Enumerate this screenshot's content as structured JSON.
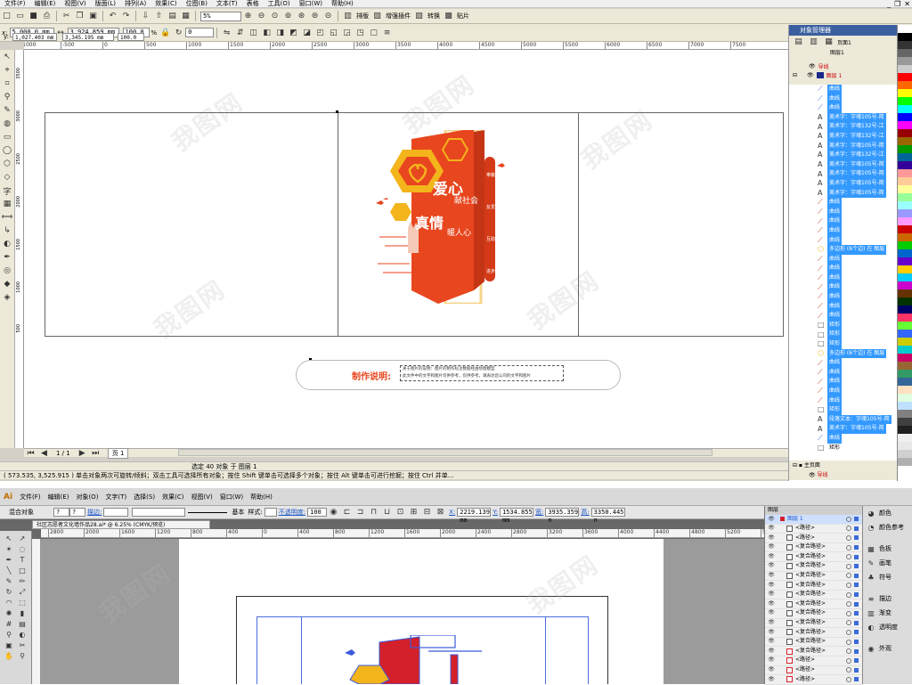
{
  "app1": {
    "menu": [
      "文件(F)",
      "编辑(E)",
      "视图(V)",
      "版面(L)",
      "排列(A)",
      "效果(C)",
      "位图(B)",
      "文本(T)",
      "表格",
      "工具(O)",
      "窗口(W)",
      "帮助(H)"
    ],
    "zoom": "5%",
    "toolbar_buttons": [
      "排版",
      "增强插件",
      "转换",
      "贴片"
    ],
    "pos_x": "5,000.0 mm",
    "pos_y": "1,027.403 mm",
    "size_w": "3,924.859 mm",
    "size_h": "3,345.195 mm",
    "scale_x": "100.0",
    "scale_y": "100.0",
    "pct": "%",
    "rotation": "0",
    "ruler_ticks": [
      "-1000",
      "-500",
      "0",
      "500",
      "1000",
      "1500",
      "2000",
      "2500",
      "3000",
      "3500",
      "4000",
      "4500",
      "5000",
      "5500",
      "6000",
      "6500",
      "7000",
      "7500"
    ],
    "v_ruler_ticks": [
      "3500",
      "3000",
      "2500",
      "2000",
      "1500",
      "1000",
      "500"
    ],
    "design_text": {
      "main1": "爱心",
      "main2": "真情",
      "sub1": "献社会",
      "sub2": "暖人心",
      "side1": "奉献",
      "side2": "友爱",
      "side3": "互助",
      "side4": "进步"
    },
    "note_label": "制作说明:",
    "note_line1": "关于图片的说明：图片的制作标注数据经由绘图模型",
    "note_line2": "此文件中的文字和图片仅供参考，仅供参考，请表达您公司的文字和图片",
    "page_nav": "1 / 1",
    "page_tab": "页 1",
    "status_selected": "选定 40 对象 于 图层 1",
    "status_coords": "( 573.535, 3,525.915 )",
    "status_hint": "单击对象两次可旋转/倾斜；双击工具可选择所有对象；按住 Shift 键单击可选择多个对象；按住 Alt 键单击可进行挖掘；按住 Ctrl 并单...",
    "docker_title": "对象管理器",
    "docker_header1": "页面1",
    "docker_header2": "图层1",
    "layer_guides": "导线",
    "layer1": "图层 1",
    "master_page": "主页面",
    "master_guides": "导线",
    "objects": [
      {
        "t": "曲线",
        "k": "curve",
        "sel": true
      },
      {
        "t": "曲线",
        "k": "curve",
        "sel": true
      },
      {
        "t": "曲线",
        "k": "curve",
        "sel": true
      },
      {
        "t": "美术字：字魂105号-简",
        "k": "text",
        "sel": true
      },
      {
        "t": "美术字：字魂132号-江",
        "k": "text",
        "sel": true
      },
      {
        "t": "美术字：字魂132号-江",
        "k": "text",
        "sel": true
      },
      {
        "t": "美术字：字魂105号-简",
        "k": "text",
        "sel": true
      },
      {
        "t": "美术字：字魂132号-江",
        "k": "text",
        "sel": true
      },
      {
        "t": "美术字：字魂105号-简",
        "k": "text",
        "sel": true
      },
      {
        "t": "美术字：字魂105号-简",
        "k": "text",
        "sel": true
      },
      {
        "t": "美术字：字魂105号-简",
        "k": "text",
        "sel": true
      },
      {
        "t": "美术字：字魂105号-简",
        "k": "text",
        "sel": true
      },
      {
        "t": "曲线",
        "k": "curvered",
        "sel": true
      },
      {
        "t": "曲线",
        "k": "curvered",
        "sel": true
      },
      {
        "t": "曲线",
        "k": "curvered",
        "sel": true
      },
      {
        "t": "曲线",
        "k": "curvered",
        "sel": true
      },
      {
        "t": "曲线",
        "k": "curvered",
        "sel": true
      },
      {
        "t": "多边形 (6个边) 在 图层",
        "k": "poly",
        "sel": true
      },
      {
        "t": "曲线",
        "k": "curvered",
        "sel": true
      },
      {
        "t": "曲线",
        "k": "curvered",
        "sel": true
      },
      {
        "t": "曲线",
        "k": "curvered",
        "sel": true
      },
      {
        "t": "曲线",
        "k": "curvered",
        "sel": true
      },
      {
        "t": "曲线",
        "k": "curvered",
        "sel": true
      },
      {
        "t": "曲线",
        "k": "curvered",
        "sel": true
      },
      {
        "t": "曲线",
        "k": "curvered",
        "sel": true
      },
      {
        "t": "矩形",
        "k": "rect",
        "sel": true
      },
      {
        "t": "矩形",
        "k": "rect",
        "sel": true
      },
      {
        "t": "矩形",
        "k": "rect",
        "sel": true
      },
      {
        "t": "多边形 (6个边) 在 图层",
        "k": "poly",
        "sel": true
      },
      {
        "t": "曲线",
        "k": "curvered",
        "sel": true
      },
      {
        "t": "曲线",
        "k": "curvered",
        "sel": true
      },
      {
        "t": "曲线",
        "k": "curvered",
        "sel": true
      },
      {
        "t": "曲线",
        "k": "curvered",
        "sel": true
      },
      {
        "t": "曲线",
        "k": "curvered",
        "sel": true
      },
      {
        "t": "矩形",
        "k": "rect",
        "sel": true
      },
      {
        "t": "段落文本：字魂105号-简",
        "k": "text",
        "sel": true
      },
      {
        "t": "美术字：字魂105号-简",
        "k": "text",
        "sel": true
      },
      {
        "t": "曲线",
        "k": "curve",
        "sel": true
      },
      {
        "t": "矩形",
        "k": "rect",
        "sel": false
      }
    ],
    "palette": [
      "#ffffff",
      "#000000",
      "#333333",
      "#666666",
      "#999999",
      "#cccccc",
      "#ff0000",
      "#ff6600",
      "#ffff00",
      "#00ff00",
      "#00ffff",
      "#0000ff",
      "#ff00ff",
      "#990000",
      "#996600",
      "#009900",
      "#006699",
      "#330099",
      "#ff9999",
      "#ffcc99",
      "#ffff99",
      "#99ff99",
      "#99ffff",
      "#9999ff",
      "#ff99ff",
      "#cc0000",
      "#cc6600",
      "#00cc00",
      "#0066cc",
      "#6600cc",
      "#ffcc00",
      "#00ccff",
      "#cc00cc",
      "#663300",
      "#003300",
      "#000066",
      "#ff3366",
      "#66ff33",
      "#3366ff",
      "#cccc00",
      "#00cccc",
      "#cc0066",
      "#996633",
      "#339966",
      "#336699",
      "#ffe0c0",
      "#e0ffe0",
      "#c0e0ff",
      "#808080",
      "#404040",
      "#202020",
      "#f0f0f0",
      "#e8e8e8",
      "#d0d0d0",
      "#b0b0b0"
    ]
  },
  "app2": {
    "menu": [
      "文件(F)",
      "编辑(E)",
      "对象(O)",
      "文字(T)",
      "选择(S)",
      "效果(C)",
      "视图(V)",
      "窗口(W)",
      "帮助(H)"
    ],
    "mixed_objects": "混合对象",
    "stroke_label": "描边:",
    "style_basic": "基本",
    "style_label": "样式:",
    "opacity_label": "不透明度:",
    "opacity_value": "100",
    "x_value": "2219.139 mm",
    "y_value": "1534.855 mm",
    "w_label": "宽:",
    "w_value": "3935.359 n",
    "h_label": "高:",
    "h_value": "3350.445 n",
    "doc_tab": "社区志愿者文化墙作品28.ai* @ 6.25% (CMYK/预览)",
    "ruler_ticks": [
      "2800",
      "2000",
      "1600",
      "1200",
      "800",
      "400",
      "0",
      "400",
      "800",
      "1200",
      "1600",
      "2000",
      "2400",
      "2800",
      "3200",
      "3600",
      "4000",
      "4400",
      "4800",
      "5200",
      "5600"
    ],
    "layers_header": "图层",
    "layer_name": "图层 1",
    "layer_rows": [
      "<路径>",
      "<路径>",
      "<复合路径>",
      "<复合路径>",
      "<复合路径>",
      "<复合路径>",
      "<复合路径>",
      "<复合路径>",
      "<复合路径>",
      "<复合路径>",
      "<复合路径>",
      "<复合路径>",
      "<复合路径>",
      "<复合路径>",
      "<路径>",
      "<路径>",
      "<路径>"
    ],
    "panels": [
      {
        "icon": "color-icon",
        "label": "颜色"
      },
      {
        "icon": "color-guide-icon",
        "label": "颜色参考"
      },
      {
        "icon": "swatches-icon",
        "label": "色板"
      },
      {
        "icon": "brushes-icon",
        "label": "画笔"
      },
      {
        "icon": "symbols-icon",
        "label": "符号"
      },
      {
        "icon": "stroke-icon",
        "label": "描边"
      },
      {
        "icon": "gradient-icon",
        "label": "渐变"
      },
      {
        "icon": "transparency-icon",
        "label": "透明度"
      },
      {
        "icon": "appearance-icon",
        "label": "外观"
      }
    ]
  }
}
